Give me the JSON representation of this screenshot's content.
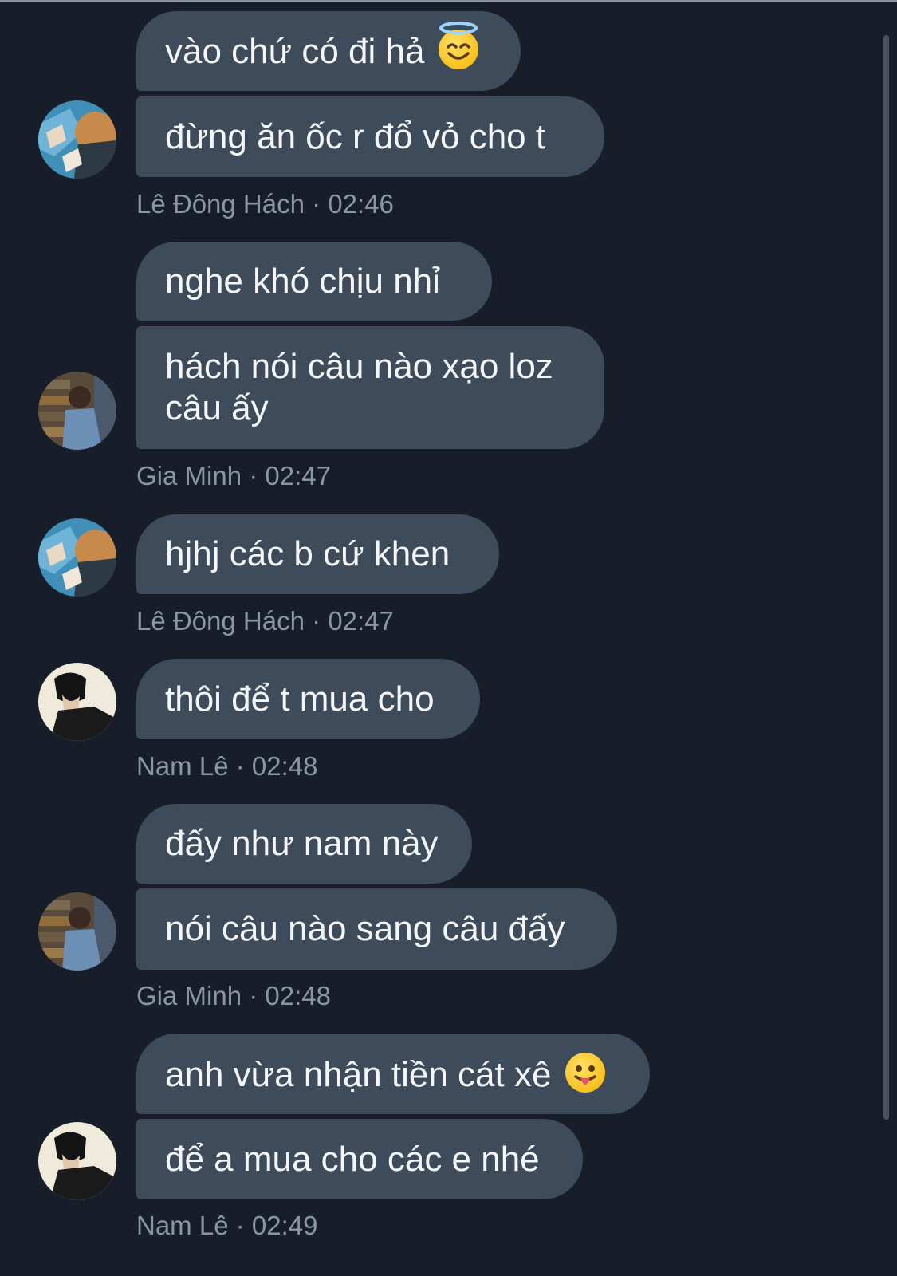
{
  "conversation": {
    "m1": {
      "text": "vào chứ có đi hả",
      "emoji": "smiling-face-with-halo"
    },
    "m2": {
      "text": "đừng ăn ốc r đổ vỏ cho t"
    },
    "meta1": "Lê Đông Hách · 02:46",
    "m3": {
      "text": "nghe khó chịu nhỉ"
    },
    "m4": {
      "line1": "hách nói câu nào xạo loz",
      "line2": "câu ấy"
    },
    "meta2": "Gia Minh · 02:47",
    "m5": {
      "text": "hjhj các b cứ khen"
    },
    "meta3": "Lê Đông Hách · 02:47",
    "m6": {
      "text": "thôi để t mua cho"
    },
    "meta4": "Nam Lê · 02:48",
    "m7": {
      "text": "đấy như nam này"
    },
    "m8": {
      "text": "nói câu nào sang câu đấy"
    },
    "meta5": "Gia Minh · 02:48",
    "m9": {
      "text": "anh vừa nhận tiền cát xê",
      "emoji": "face-with-tongue"
    },
    "m10": {
      "text": "để a mua cho các e nhé"
    },
    "meta6": "Nam Lê · 02:49"
  },
  "colors": {
    "background": "#171e2a",
    "bubble": "#3d4b5b",
    "bubble_text": "#f4f6f9",
    "meta_text": "#8b96a4"
  }
}
